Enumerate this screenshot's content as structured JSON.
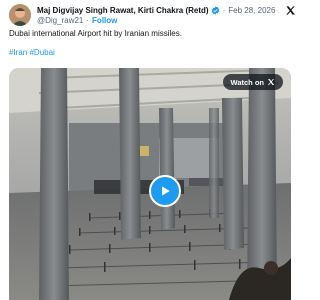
{
  "post": {
    "author_name": "Maj Digvijay Singh Rawat, Kirti Chakra (Retd)",
    "handle": "@Dig_raw21",
    "separator": "·",
    "follow_label": "Follow",
    "date": "Feb 28, 2026",
    "text": "Dubai international Airport hit by Iranian missiles.",
    "hashtags": [
      "#Iran",
      "#Dubai"
    ]
  },
  "media": {
    "watch_label": "Watch on"
  },
  "colors": {
    "accent": "#1d9bf0",
    "secondary_text": "#536471",
    "primary_text": "#0f1419"
  },
  "icons": {
    "verified": "verified-badge-icon",
    "platform": "x-logo-icon",
    "play": "play-icon"
  }
}
